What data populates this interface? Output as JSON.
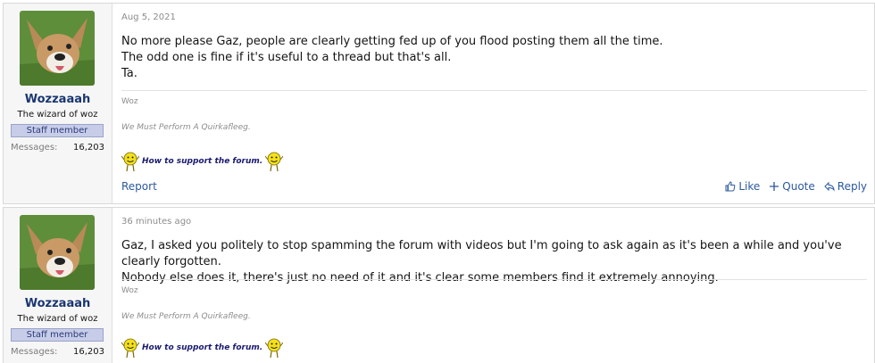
{
  "posts": [
    {
      "author": {
        "name": "Wozzaaah",
        "title": "The wizard of woz",
        "badge": "Staff member",
        "messages_label": "Messages:",
        "messages_count": "16,203"
      },
      "date": "Aug 5, 2021",
      "lines": [
        "No more please Gaz, people are clearly getting fed up of you flood posting them all the time.",
        "The odd one is fine if it's useful to a thread but that's all.",
        "Ta."
      ],
      "signature": {
        "name": "Woz",
        "quote": "We Must Perform A Quirkafleeg.",
        "link": "How to support the forum."
      },
      "actions": {
        "report": "Report",
        "like": "Like",
        "quote": "Quote",
        "reply": "Reply"
      }
    },
    {
      "author": {
        "name": "Wozzaaah",
        "title": "The wizard of woz",
        "badge": "Staff member",
        "messages_label": "Messages:",
        "messages_count": "16,203"
      },
      "date": "36 minutes ago",
      "lines": [
        "Gaz, I asked you politely to stop spamming the forum with videos but I'm going to ask again as it's been a while and you've clearly forgotten.",
        "Nobody else does it, there's just no need of it and it's clear some members find it extremely annoying."
      ],
      "signature": {
        "name": "Woz",
        "quote": "We Must Perform A Quirkafleeg.",
        "link": "How to support the forum."
      }
    }
  ],
  "icons": {
    "like": "thumbs-up-icon",
    "quote": "plus-icon",
    "reply": "reply-arrow-icon",
    "smiley": "waving-smiley-icon"
  },
  "colors": {
    "username": "#1a3670",
    "link": "#2c58a0",
    "badge_bg": "#c7cde8",
    "support_link": "#1a1a6e"
  }
}
